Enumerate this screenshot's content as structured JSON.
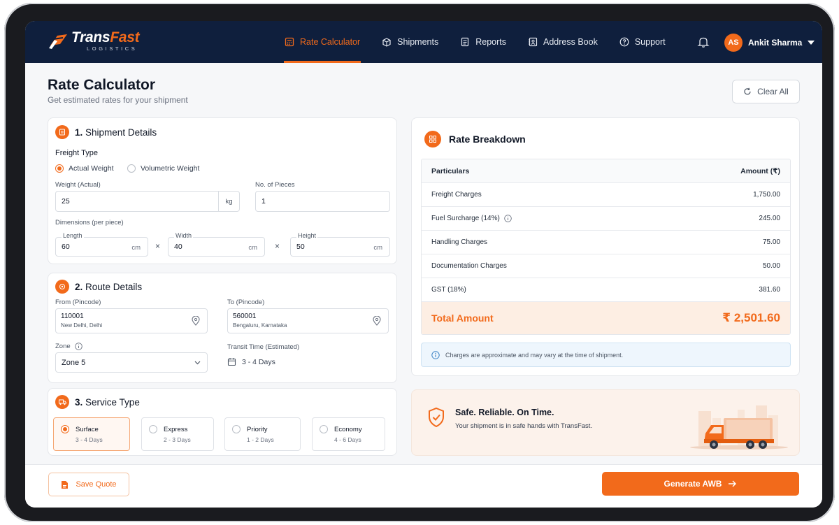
{
  "brand": {
    "name_a": "Trans",
    "name_b": "Fast",
    "sub": "LOGISTICS",
    "accent": "#f26a1b",
    "navy": "#0f1f3d"
  },
  "nav": {
    "items": [
      {
        "label": "Rate Calculator",
        "icon": "calculator-icon",
        "active": true
      },
      {
        "label": "Shipments",
        "icon": "box-icon"
      },
      {
        "label": "Reports",
        "icon": "document-icon"
      },
      {
        "label": "Address Book",
        "icon": "address-book-icon"
      },
      {
        "label": "Support",
        "icon": "help-circle-icon"
      }
    ]
  },
  "user": {
    "initials": "AS",
    "name": "Ankit Sharma"
  },
  "page": {
    "title": "Rate Calculator",
    "subtitle": "Get estimated rates for your shipment",
    "clear_label": "Clear All"
  },
  "shipment": {
    "num": "1.",
    "title": "Shipment Details",
    "freight_type_label": "Freight Type",
    "freight_options": [
      "Actual Weight",
      "Volumetric Weight"
    ],
    "freight_selected": "Actual Weight",
    "weight_label": "Weight (Actual)",
    "weight_value": "25",
    "weight_unit": "kg",
    "pieces_label": "No. of Pieces",
    "pieces_value": "1",
    "dimensions_label": "Dimensions (per piece)",
    "length_label": "Length",
    "length_value": "60",
    "width_label": "Width",
    "width_value": "40",
    "height_label": "Height",
    "height_value": "50",
    "dim_unit": "cm",
    "times": "×"
  },
  "route": {
    "num": "2.",
    "title": "Route Details",
    "from_label": "From (Pincode)",
    "from_code": "110001",
    "from_city": "New Delhi, Delhi",
    "to_label": "To (Pincode)",
    "to_code": "560001",
    "to_city": "Bengaluru, Karnataka",
    "zone_label": "Zone",
    "zone_value": "Zone 5",
    "transit_label": "Transit Time (Estimated)",
    "transit_value": "3 - 4 Days"
  },
  "service": {
    "num": "3.",
    "title": "Service Type",
    "options": [
      {
        "name": "Surface",
        "days": "3 - 4 Days",
        "selected": true
      },
      {
        "name": "Express",
        "days": "2 - 3 Days"
      },
      {
        "name": "Priority",
        "days": "1 - 2 Days"
      },
      {
        "name": "Economy",
        "days": "4 - 6 Days"
      }
    ]
  },
  "breakdown": {
    "title": "Rate Breakdown",
    "col_particulars": "Particulars",
    "col_amount": "Amount (₹)",
    "rows": [
      {
        "label": "Freight Charges",
        "amount": "1,750.00"
      },
      {
        "label": "Fuel Surcharge (14%)",
        "amount": "245.00",
        "info": true
      },
      {
        "label": "Handling Charges",
        "amount": "75.00"
      },
      {
        "label": "Documentation Charges",
        "amount": "50.00"
      },
      {
        "label": "GST (18%)",
        "amount": "381.60"
      }
    ],
    "total_label": "Total Amount",
    "total_value": "₹ 2,501.60",
    "note": "Charges are approximate and may vary at the time of shipment."
  },
  "safe": {
    "title": "Safe. Reliable. On Time.",
    "subtitle": "Your shipment is in safe hands with TransFast."
  },
  "footer": {
    "save_label": "Save Quote",
    "awb_label": "Generate AWB"
  }
}
